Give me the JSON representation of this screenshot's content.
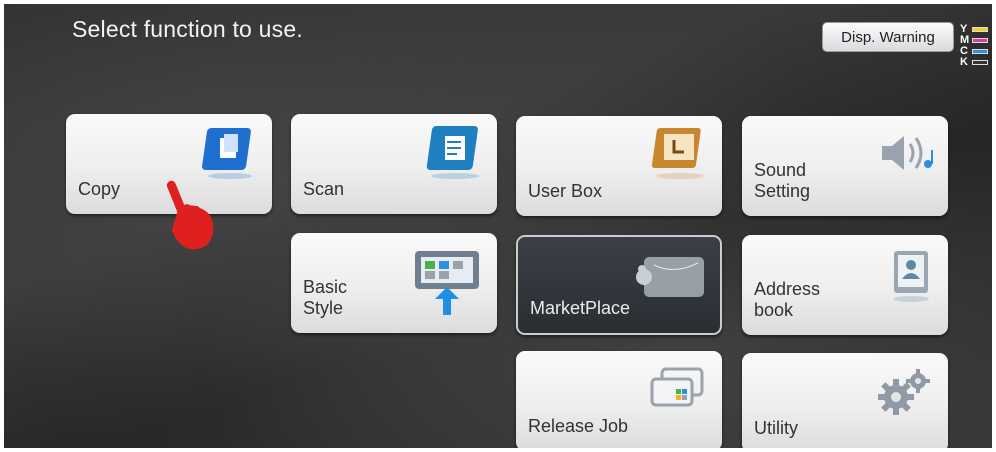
{
  "header": {
    "title": "Select function to use."
  },
  "warning_button": {
    "label": "Disp. Warning"
  },
  "toner": [
    {
      "letter": "Y",
      "color": "#f2d21a"
    },
    {
      "letter": "M",
      "color": "#e23aa6"
    },
    {
      "letter": "C",
      "color": "#2f8fe0"
    },
    {
      "letter": "K",
      "color": "#333333"
    }
  ],
  "tiles": {
    "copy": {
      "label": "Copy"
    },
    "scan": {
      "label": "Scan"
    },
    "user_box": {
      "label": "User Box"
    },
    "sound_setting": {
      "label": "Sound\nSetting"
    },
    "basic_style": {
      "label": "Basic\nStyle"
    },
    "marketplace": {
      "label": "MarketPlace"
    },
    "address_book": {
      "label": "Address\nbook"
    },
    "release_job": {
      "label": "Release Job"
    },
    "utility": {
      "label": "Utility"
    }
  },
  "icons": {
    "copy": "copy-icon",
    "scan": "scan-icon",
    "user_box": "user-box-icon",
    "sound_setting": "speaker-icon",
    "basic_style": "basic-style-icon",
    "marketplace": "marketplace-icon",
    "address_book": "address-book-icon",
    "release_job": "release-job-icon",
    "utility": "gear-icon",
    "pointer": "hand-pointer-icon"
  },
  "colors": {
    "accent_blue": "#1f6fd1",
    "pointer_red": "#e01f1f",
    "folder_orange": "#c8862f"
  }
}
